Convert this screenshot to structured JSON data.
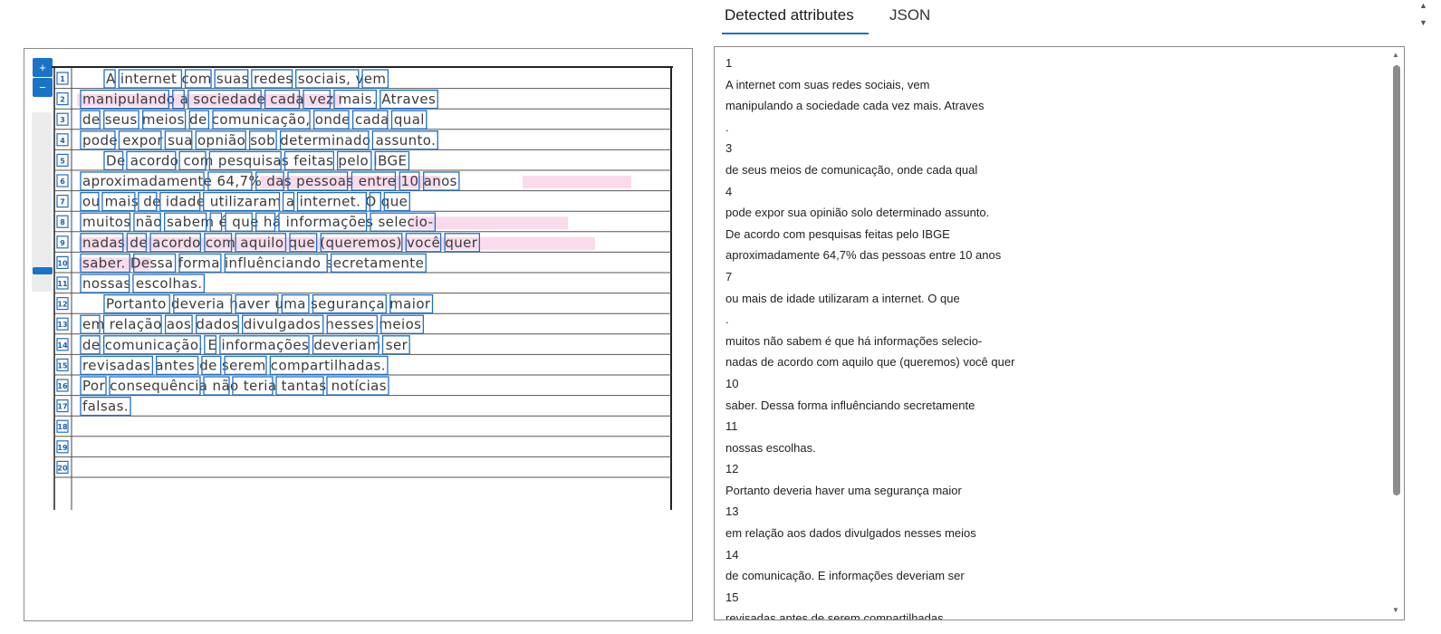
{
  "tabs": [
    {
      "label": "Detected attributes",
      "active": true
    },
    {
      "label": "JSON",
      "active": false
    }
  ],
  "image_viewer": {
    "zoom_in_label": "+",
    "zoom_out_label": "−",
    "line_numbers": [
      "1",
      "2",
      "3",
      "4",
      "5",
      "6",
      "7",
      "8",
      "9",
      "10",
      "11",
      "12",
      "13",
      "14",
      "15",
      "16",
      "17",
      "18",
      "19",
      "20"
    ],
    "handwritten_lines": [
      "A internet com suas redes sociais, vem",
      "manipulando a sociedade cada vez mais. Atraves",
      "de seus meios de comunicação, onde cada qual",
      "pode expor sua opnião sob determinado assunto.",
      "De acordo com pesquisas feitas pelo IBGE",
      "aproximadamente 64,7% das pessoas entre 10 anos",
      "ou mais de idade utilizaram a internet. O que",
      "muitos não sabem é que há informações selecio-",
      "nadas de acordo com aquilo que (queremos) você quer",
      "saber. Dessa forma influênciando secretamente",
      "nossas escolhas.",
      "Portanto deveria haver uma segurança maior",
      "em relação aos dados divulgados nesses meios",
      "de comunicação. E informações deveriam ser",
      "revisadas antes de serem compartilhadas.",
      "Por consequência não teria tantas notícias",
      "falsas.",
      "",
      "",
      ""
    ]
  },
  "detected_text": [
    "1",
    "A internet com suas redes sociais, vem",
    "manipulando a sociedade cada vez mais. Atraves",
    ".",
    "3",
    "de seus meios de comunicação, onde cada qual",
    "4",
    "pode expor sua opinião solo determinado assunto.",
    "De acordo com pesquisas feitas pelo IBGE",
    "aproximadamente 64,7% das pessoas entre 10 anos",
    "7",
    "ou mais de idade utilizaram a internet. O que",
    ".",
    "muitos não sabem é que há informações selecio-",
    "nadas de acordo com aquilo que (queremos) você quer",
    "10",
    "saber. Dessa forma influênciando secretamente",
    "11",
    "nossas escolhas.",
    "12",
    "Portanto deveria haver uma segurança maior",
    "13",
    "em relação aos dados divulgados nesses meios",
    "14",
    "de comunicação. E informações deveriam ser",
    "15",
    "revisadas antes de serem compartilhadas."
  ],
  "colors": {
    "accent": "#1a73c6",
    "box": "#1f6fc4",
    "highlight": "#f7cfe6"
  },
  "icons": {
    "zoom_in": "plus-icon",
    "zoom_out": "minus-icon",
    "scroll_up": "triangle-up-icon",
    "scroll_down": "triangle-down-icon"
  }
}
